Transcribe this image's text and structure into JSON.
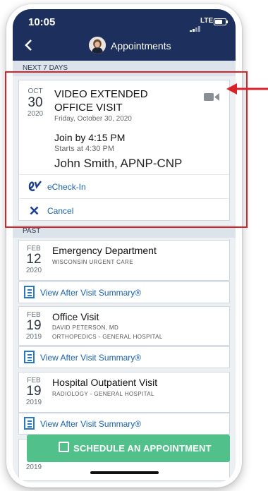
{
  "status_bar": {
    "time": "10:05",
    "network": "LTE"
  },
  "nav": {
    "title": "Appointments"
  },
  "sections": {
    "upcoming": "NEXT 7 DAYS",
    "past": "PAST"
  },
  "upcoming": {
    "month": "OCT",
    "day": "30",
    "year": "2020",
    "title_line1": "VIDEO EXTENDED",
    "title_line2": "OFFICE VISIT",
    "full_date": "Friday, October 30, 2020",
    "join_label": "Join by",
    "join_time": "4:15 PM",
    "starts": "Starts at 4:30 PM",
    "provider": "John Smith, APNP-CNP",
    "echeckin_label": "eCheck-In",
    "cancel_label": "Cancel"
  },
  "past": [
    {
      "month": "FEB",
      "day": "12",
      "year": "2020",
      "title": "Emergency Department",
      "line1": "WISCONSIN URGENT CARE",
      "line2": "",
      "link": "View After Visit Summary®"
    },
    {
      "month": "FEB",
      "day": "19",
      "year": "2019",
      "title": "Office Visit",
      "line1": "DAVID PETERSON, MD",
      "line2": "ORTHOPEDICS - GENERAL HOSPITAL",
      "link": "View After Visit Summary®"
    },
    {
      "month": "FEB",
      "day": "19",
      "year": "2019",
      "title": "Hospital Outpatient Visit",
      "line1": "RADIOLOGY - GENERAL HOSPITAL",
      "line2": "",
      "link": "View After Visit Summary®"
    }
  ],
  "peek_year": "2019",
  "schedule_button": "SCHEDULE AN APPOINTMENT",
  "colors": {
    "navy": "#1d2f5c",
    "link_blue": "#1b62ad",
    "green": "#52c08b",
    "highlight_red": "#d8232a"
  }
}
